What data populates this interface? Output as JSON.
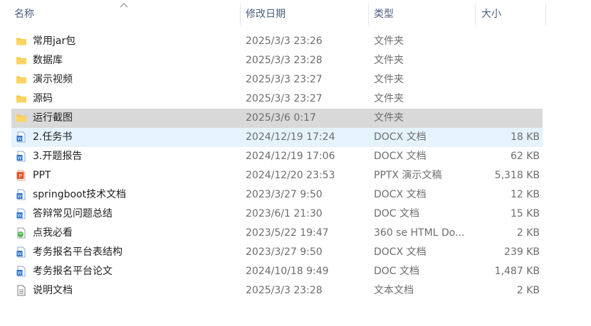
{
  "columns": {
    "name": "名称",
    "date": "修改日期",
    "type": "类型",
    "size": "大小"
  },
  "files": [
    {
      "name": "常用jar包",
      "date": "2025/3/3 23:26",
      "type": "文件夹",
      "size": "",
      "icon": "folder-icon"
    },
    {
      "name": "数据库",
      "date": "2025/3/3 23:28",
      "type": "文件夹",
      "size": "",
      "icon": "folder-icon"
    },
    {
      "name": "演示视频",
      "date": "2025/3/3 23:27",
      "type": "文件夹",
      "size": "",
      "icon": "folder-icon"
    },
    {
      "name": "源码",
      "date": "2025/3/3 23:27",
      "type": "文件夹",
      "size": "",
      "icon": "folder-icon"
    },
    {
      "name": "运行截图",
      "date": "2025/3/6 0:17",
      "type": "文件夹",
      "size": "",
      "icon": "folder-icon"
    },
    {
      "name": "2.任务书",
      "date": "2024/12/19 17:24",
      "type": "DOCX 文档",
      "size": "18 KB",
      "icon": "word-doc-icon"
    },
    {
      "name": "3.开题报告",
      "date": "2024/12/19 17:06",
      "type": "DOCX 文档",
      "size": "62 KB",
      "icon": "word-doc-icon"
    },
    {
      "name": "PPT",
      "date": "2024/12/20 23:53",
      "type": "PPTX 演示文稿",
      "size": "5,318 KB",
      "icon": "powerpoint-icon"
    },
    {
      "name": "springboot技术文档",
      "date": "2023/3/27 9:50",
      "type": "DOCX 文档",
      "size": "12 KB",
      "icon": "word-doc-icon"
    },
    {
      "name": "答辩常见问题总结",
      "date": "2023/6/1 21:30",
      "type": "DOC 文档",
      "size": "15 KB",
      "icon": "word-doc-icon"
    },
    {
      "name": "点我必看",
      "date": "2023/5/22 19:47",
      "type": "360 se HTML Do...",
      "size": "2 KB",
      "icon": "html-document-icon"
    },
    {
      "name": "考务报名平台表结构",
      "date": "2023/3/27 9:50",
      "type": "DOCX 文档",
      "size": "239 KB",
      "icon": "word-doc-icon"
    },
    {
      "name": "考务报名平台论文",
      "date": "2024/10/18 9:49",
      "type": "DOC 文档",
      "size": "1,487 KB",
      "icon": "word-doc-icon"
    },
    {
      "name": "说明文档",
      "date": "2025/3/3 23:28",
      "type": "文本文档",
      "size": "2 KB",
      "icon": "text-document-icon"
    }
  ],
  "selected_row": 4,
  "hover_row": 5,
  "colors": {
    "folder": "#f8c948",
    "word": "#2b6fd6",
    "powerpoint": "#e2582b",
    "selected_bg": "#d9d9d9",
    "hover_bg": "#e5f3ff"
  }
}
